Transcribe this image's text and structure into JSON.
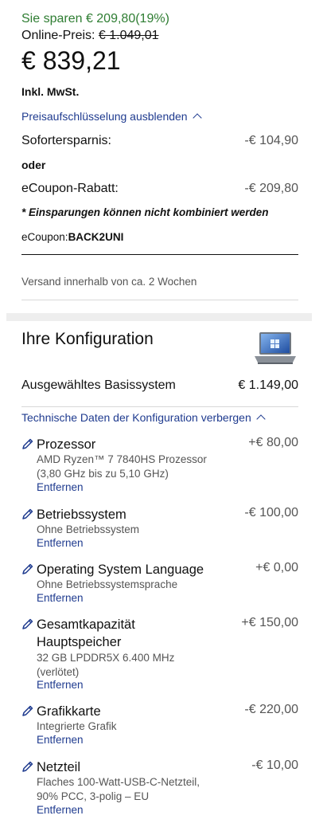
{
  "pricing": {
    "savings_text": "Sie sparen € 209,80(19%)",
    "online_label": "Online-Preis: ",
    "online_price": "€ 1.049,01",
    "current_price": "€ 839,21",
    "vat_note": "Inkl. MwSt.",
    "breakdown_toggle": "Preisaufschlüsselung ausblenden",
    "instant_savings_label": "Sofortersparnis:",
    "instant_savings_value": "-€ 104,90",
    "or_label": "oder",
    "ecoupon_label": "eCoupon-Rabatt:",
    "ecoupon_value": "-€ 209,80",
    "combine_note": "* Einsparungen können nicht kombiniert werden",
    "coupon_label": "eCoupon:",
    "coupon_code": "BACK2UNI",
    "shipping_text": "Versand innerhalb von ca. 2 Wochen"
  },
  "configuration": {
    "title": "Ihre Konfiguration",
    "base_label": "Ausgewähltes Basissystem",
    "base_price": "€ 1.149,00",
    "tech_toggle": "Technische Daten der Konfiguration verbergen",
    "items": [
      {
        "name": "Prozessor",
        "price": "+€ 80,00",
        "desc": "AMD Ryzen™ 7 7840HS Prozessor (3,80 GHz bis zu 5,10 GHz)",
        "remove": "Entfernen"
      },
      {
        "name": "Betriebssystem",
        "price": "-€ 100,00",
        "desc": "Ohne Betriebssystem",
        "remove": "Entfernen"
      },
      {
        "name": "Operating System Language",
        "price": "+€ 0,00",
        "desc": "Ohne Betriebssystemsprache",
        "remove": "Entfernen"
      },
      {
        "name": "Gesamtkapazität Hauptspeicher",
        "price": "+€ 150,00",
        "desc": "32 GB LPDDR5X 6.400 MHz (verlötet)",
        "remove": "Entfernen"
      },
      {
        "name": "Grafikkarte",
        "price": "-€ 220,00",
        "desc": "Integrierte Grafik",
        "remove": "Entfernen"
      },
      {
        "name": "Netzteil",
        "price": "-€ 10,00",
        "desc": "Flaches 100-Watt-USB-C-Netzteil, 90% PCC, 3-polig – EU",
        "remove": "Entfernen"
      }
    ]
  },
  "icons": {
    "edit": "pencil-icon",
    "toggle": "chevron-up-icon",
    "product": "laptop-image"
  },
  "colors": {
    "savings": "#2e7d32",
    "link": "#1f3b8f",
    "muted": "#555555"
  }
}
